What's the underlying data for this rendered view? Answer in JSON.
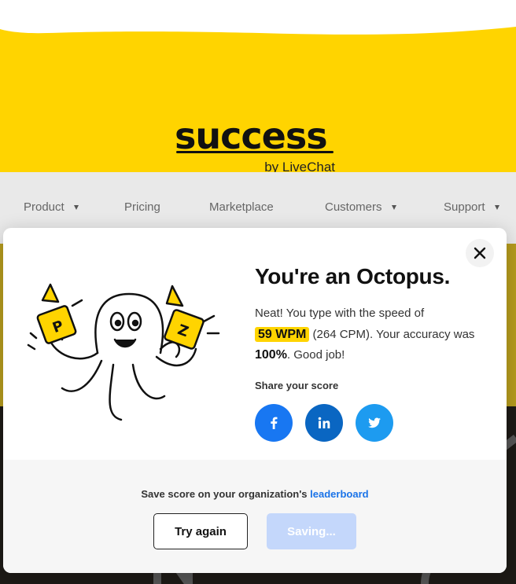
{
  "logo": {
    "word": "success",
    "sub": "by LiveChat"
  },
  "nav": {
    "items": [
      {
        "label": "Product",
        "has_caret": true
      },
      {
        "label": "Pricing",
        "has_caret": false
      },
      {
        "label": "Marketplace",
        "has_caret": false
      },
      {
        "label": "Customers",
        "has_caret": true
      },
      {
        "label": "Support",
        "has_caret": true
      }
    ]
  },
  "modal": {
    "heading": "You're an Octopus.",
    "result": {
      "intro": "Neat! You type with the speed of",
      "wpm": "59 WPM",
      "cpm": "(264 CPM). Your accuracy was",
      "accuracy": "100%",
      "outro": ". Good job!"
    },
    "share_label": "Share your score",
    "share": [
      {
        "network": "facebook",
        "icon": "facebook-icon",
        "color": "#1877f2"
      },
      {
        "network": "linkedin",
        "icon": "linkedin-icon",
        "color": "#0a66c2"
      },
      {
        "network": "twitter",
        "icon": "twitter-icon",
        "color": "#1d9bf0"
      }
    ],
    "footer": {
      "save_prefix": "Save score on your organization's",
      "save_link": "leaderboard",
      "try_again": "Try again",
      "saving": "Saving..."
    }
  },
  "colors": {
    "brand_yellow": "#ffd400",
    "link_blue": "#1a73e8"
  }
}
